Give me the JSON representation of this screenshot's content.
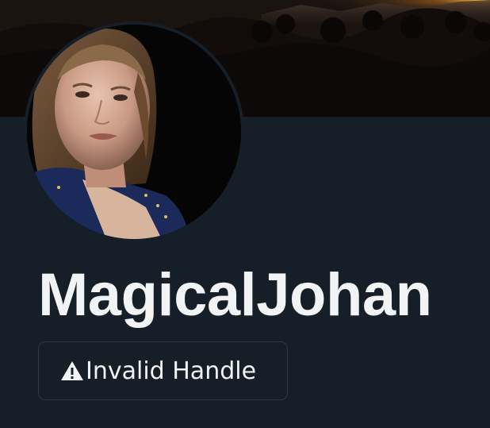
{
  "profile": {
    "display_name": "MagicalJohan",
    "handle_status": "Invalid Handle",
    "status_icon": "warning-triangle-icon",
    "avatar_description_icon": "avatar"
  },
  "colors": {
    "background": "#161e27",
    "text": "#f1f3f5",
    "pill_border": "#2c3947"
  }
}
